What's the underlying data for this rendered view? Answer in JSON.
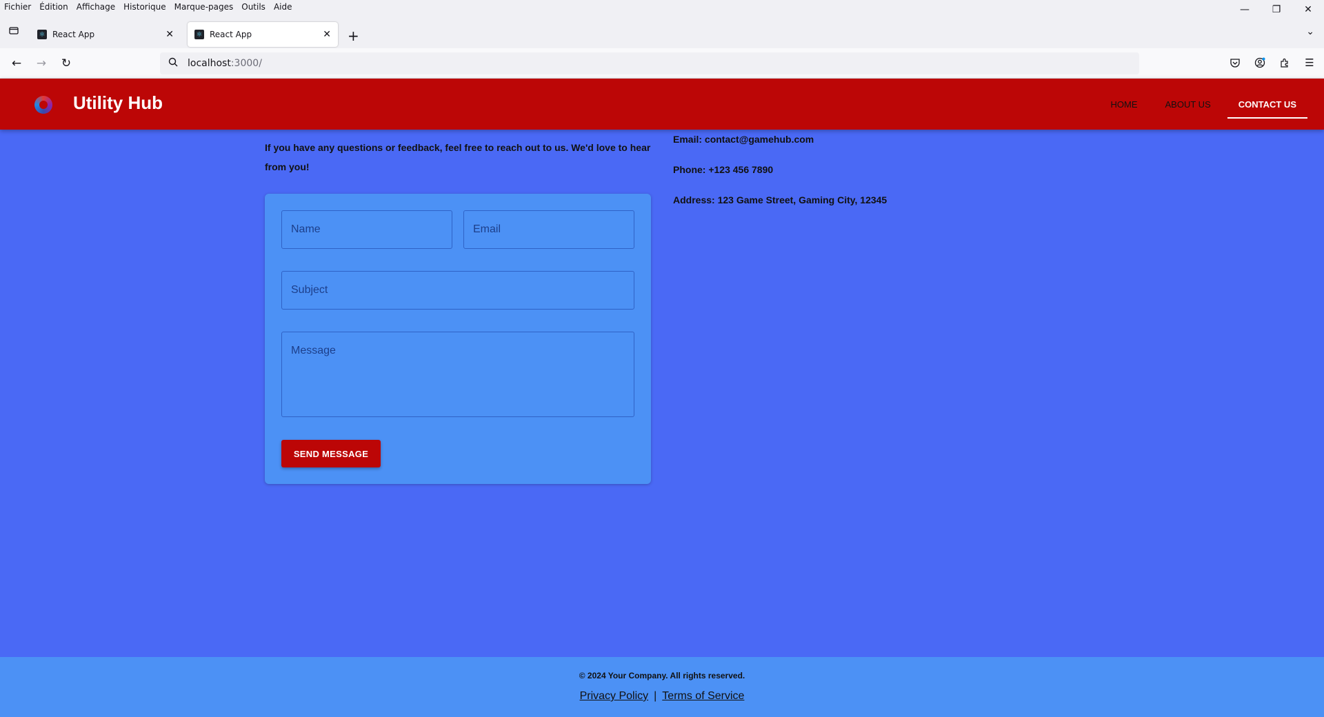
{
  "browser": {
    "menu": [
      "Fichier",
      "Édition",
      "Affichage",
      "Historique",
      "Marque-pages",
      "Outils",
      "Aide"
    ],
    "tabs": [
      {
        "title": "React App",
        "active": false
      },
      {
        "title": "React App",
        "active": true
      }
    ],
    "url_host": "localhost",
    "url_rest": ":3000/"
  },
  "header": {
    "title": "Utility Hub",
    "nav": [
      {
        "label": "HOME",
        "active": false
      },
      {
        "label": "ABOUT US",
        "active": false
      },
      {
        "label": "CONTACT US",
        "active": true
      }
    ]
  },
  "main": {
    "intro": "If you have any questions or feedback, feel free to reach out to us. We'd love to hear from you!",
    "contact": {
      "email": "Email: contact@gamehub.com",
      "phone": "Phone: +123 456 7890",
      "address": "Address: 123 Game Street, Gaming City, 12345"
    },
    "form": {
      "name_placeholder": "Name",
      "email_placeholder": "Email",
      "subject_placeholder": "Subject",
      "message_placeholder": "Message",
      "submit_label": "SEND MESSAGE"
    }
  },
  "footer": {
    "copyright": "© 2024 Your Company. All rights reserved.",
    "privacy": "Privacy Policy",
    "separator": "|",
    "terms": "Terms of Service"
  }
}
